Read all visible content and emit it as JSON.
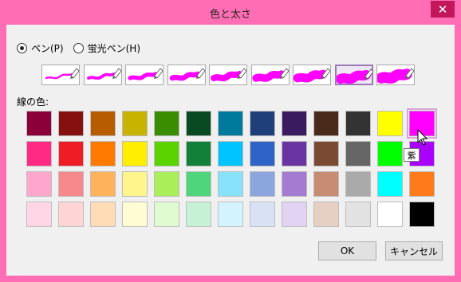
{
  "window": {
    "title": "色と太さ",
    "close_glyph": "✕"
  },
  "mode": {
    "pen_label": "ペン(P)",
    "highlighter_label": "蛍光ペン(H)",
    "selected": "pen"
  },
  "pens": [
    {
      "size": 1
    },
    {
      "size": 2
    },
    {
      "size": 3
    },
    {
      "size": 4
    },
    {
      "size": 5
    },
    {
      "size": 6
    },
    {
      "size": 7
    },
    {
      "size": 8
    },
    {
      "size": 9
    }
  ],
  "selected_pen_index": 7,
  "pen_color": "#ff00ff",
  "line_color_label": "線の色:",
  "palette": [
    [
      "#8b0038",
      "#860f0f",
      "#b85c00",
      "#c8b400",
      "#3a8c00",
      "#0a4a22",
      "#007a9c",
      "#1f3f7a",
      "#3b1b60",
      "#4a2a1a",
      "#333333",
      "#ffff00",
      "#ff00ff"
    ],
    [
      "#ff2a84",
      "#f01c24",
      "#ff7a00",
      "#ffee00",
      "#5ad300",
      "#128038",
      "#00c4ff",
      "#2f64c6",
      "#6a35a2",
      "#7b4a32",
      "#666666",
      "#00ff00",
      "#aa00ff"
    ],
    [
      "#ffa6cc",
      "#f7888c",
      "#ffb25c",
      "#fff58c",
      "#a8ef5a",
      "#4fd67a",
      "#88e2fb",
      "#8aa6dc",
      "#a47bd1",
      "#c78c72",
      "#aaaaaa",
      "#00ffff",
      "#ff7a1a"
    ],
    [
      "#ffd6e6",
      "#ffd4d5",
      "#ffdcb5",
      "#fffbd2",
      "#e0fbd0",
      "#c6f1d4",
      "#d2f3ff",
      "#d9e2f5",
      "#e1d3f1",
      "#e6d0c4",
      "#e2e2e2",
      "#ffffff",
      "#000000"
    ]
  ],
  "selected_color": "#ff00ff",
  "tooltip": "紫",
  "buttons": {
    "ok": "OK",
    "cancel": "キャンセル"
  }
}
